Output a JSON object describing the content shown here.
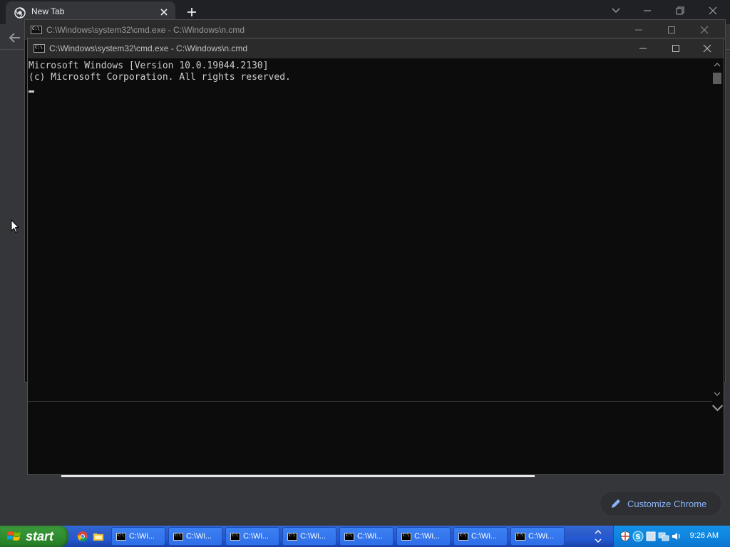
{
  "chrome": {
    "tab_title": "New Tab",
    "customize_label": "Customize Chrome"
  },
  "cmd_back": {
    "title": "C:\\Windows\\system32\\cmd.exe - C:\\Windows\\n.cmd"
  },
  "cmd_front": {
    "title": "C:\\Windows\\system32\\cmd.exe - C:\\Windows\\n.cmd",
    "icon_text": "C:\\",
    "lines": [
      "Microsoft Windows [Version 10.0.19044.2130]",
      "(c) Microsoft Corporation. All rights reserved."
    ]
  },
  "taskbar": {
    "start_label": "start",
    "items": [
      {
        "label": "C:\\Wi..."
      },
      {
        "label": "C:\\Wi..."
      },
      {
        "label": "C:\\Wi..."
      },
      {
        "label": "C:\\Wi..."
      },
      {
        "label": "C:\\Wi..."
      },
      {
        "label": "C:\\Wi..."
      },
      {
        "label": "C:\\Wi..."
      },
      {
        "label": "C:\\Wi..."
      }
    ],
    "clock": "9:26 AM"
  },
  "icons": {
    "chrome_tab": "chrome-logo-icon",
    "tray": [
      "shield-icon",
      "skype-icon",
      "display-icon",
      "network-icon",
      "volume-icon"
    ]
  }
}
